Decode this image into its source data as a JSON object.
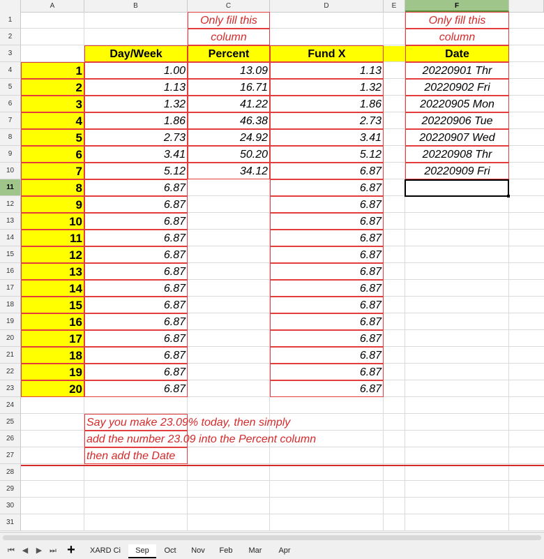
{
  "columns": [
    "A",
    "B",
    "C",
    "D",
    "E",
    "F"
  ],
  "active_column": "F",
  "rows": [
    "1",
    "2",
    "3",
    "4",
    "5",
    "6",
    "7",
    "8",
    "9",
    "10",
    "11",
    "12",
    "13",
    "14",
    "15",
    "16",
    "17",
    "18",
    "19",
    "20",
    "21",
    "22",
    "23",
    "24",
    "25",
    "26",
    "27",
    "28",
    "29",
    "30",
    "31"
  ],
  "active_row": "11",
  "notes": {
    "c_line1": "Only fill this",
    "c_line2": "column",
    "f_line1": "Only fill this",
    "f_line2": "column",
    "bottom_line1": "Say you make 23.09% today, then simply",
    "bottom_line2": "add the number 23.09 into the Percent column",
    "bottom_line3": "then add the Date"
  },
  "headers": {
    "day_week": "Day/Week",
    "percent": "Percent",
    "fund_x": "Fund X",
    "date": "Date"
  },
  "table": {
    "index": [
      "1",
      "2",
      "3",
      "4",
      "5",
      "6",
      "7",
      "8",
      "9",
      "10",
      "11",
      "12",
      "13",
      "14",
      "15",
      "16",
      "17",
      "18",
      "19",
      "20"
    ],
    "day_week": [
      "1.00",
      "1.13",
      "1.32",
      "1.86",
      "2.73",
      "3.41",
      "5.12",
      "6.87",
      "6.87",
      "6.87",
      "6.87",
      "6.87",
      "6.87",
      "6.87",
      "6.87",
      "6.87",
      "6.87",
      "6.87",
      "6.87",
      "6.87"
    ],
    "percent": [
      "13.09",
      "16.71",
      "41.22",
      "46.38",
      "24.92",
      "50.20",
      "34.12"
    ],
    "fund_x": [
      "1.13",
      "1.32",
      "1.86",
      "2.73",
      "3.41",
      "5.12",
      "6.87",
      "6.87",
      "6.87",
      "6.87",
      "6.87",
      "6.87",
      "6.87",
      "6.87",
      "6.87",
      "6.87",
      "6.87",
      "6.87",
      "6.87",
      "6.87"
    ],
    "dates": [
      "20220901 Thr",
      "20220902 Fri",
      "20220905 Mon",
      "20220906 Tue",
      "20220907 Wed",
      "20220908 Thr",
      "20220909 Fri"
    ]
  },
  "sheet_tabs": [
    "XARD Ci",
    "Sep",
    "Oct",
    "Nov",
    "Feb",
    "Mar",
    "Apr"
  ],
  "active_tab": "Sep",
  "icons": {
    "first": "first-sheet-icon",
    "prev": "prev-sheet-icon",
    "next": "next-sheet-icon",
    "last": "last-sheet-icon",
    "add": "add-sheet-icon"
  },
  "colors": {
    "highlight": "#ffff00",
    "note_red": "#d62a2a",
    "active_header": "#9fc58a"
  }
}
